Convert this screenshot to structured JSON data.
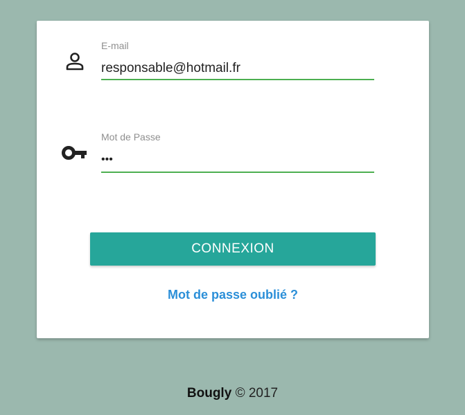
{
  "login": {
    "email_label": "E-mail",
    "email_value": "responsable@hotmail.fr",
    "password_label": "Mot de Passe",
    "password_value": "•••",
    "submit_label": "CONNEXION",
    "forgot_label": "Mot de passe oublié ?"
  },
  "icons": {
    "email": "person-icon",
    "password": "key-icon"
  },
  "footer": {
    "brand": "Bougly",
    "copyright": "© 2017"
  },
  "colors": {
    "background": "#9bb8ae",
    "accent": "#26a69a",
    "field_underline": "#4caf50",
    "link": "#2b8fd8"
  }
}
